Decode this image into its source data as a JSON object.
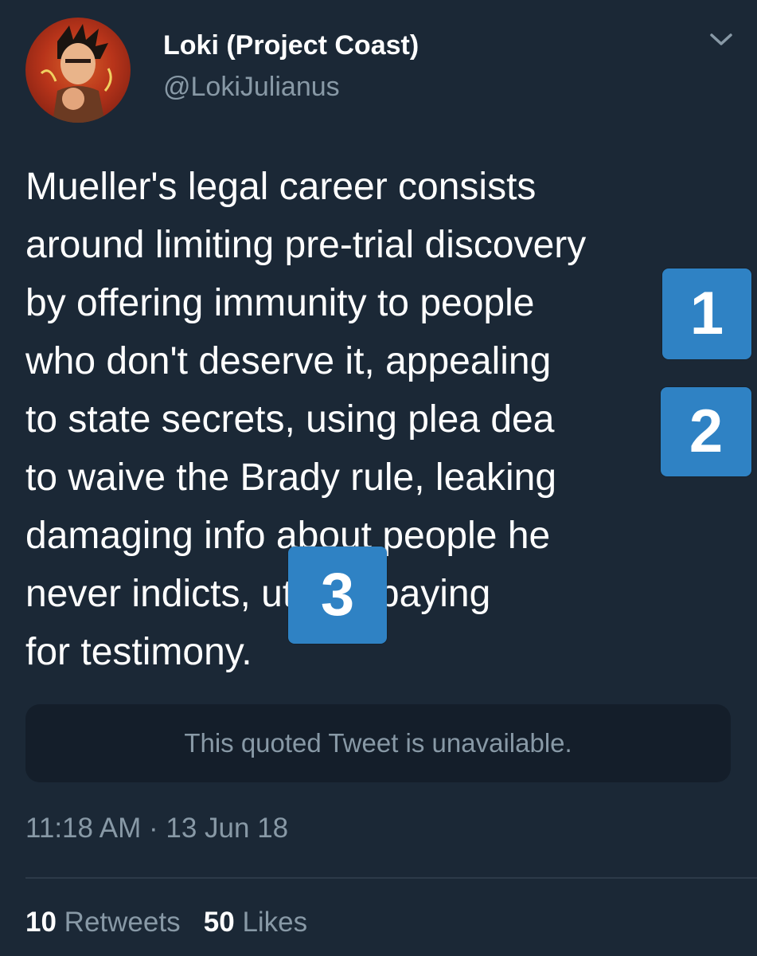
{
  "header": {
    "display_name": "Loki (Project Coast)",
    "handle": "@LokiJulianus",
    "menu_icon": "chevron-down-icon"
  },
  "tweet": {
    "lines": [
      "Mueller's legal career consists",
      "around limiting pre-trial discovery",
      "by offering immunity to people",
      "who don't deserve it, appealing",
      "to state secrets, using plea dea",
      "to waive the Brady rule, leaking",
      "damaging info about people he",
      "never indicts,      utright paying",
      "for testimony."
    ]
  },
  "annotations": {
    "badge_1": "1",
    "badge_2": "2",
    "badge_3": "3",
    "badge_color": "#2f82c4"
  },
  "quoted_tweet": {
    "text": "This quoted Tweet is unavailable."
  },
  "meta": {
    "timestamp": "11:18 AM · 13 Jun 18"
  },
  "stats": {
    "retweets_count": "10",
    "retweets_label": "Retweets",
    "likes_count": "50",
    "likes_label": "Likes"
  },
  "colors": {
    "background": "#1b2836",
    "secondary_text": "#8899a6",
    "quoted_bg": "#141e2a"
  }
}
